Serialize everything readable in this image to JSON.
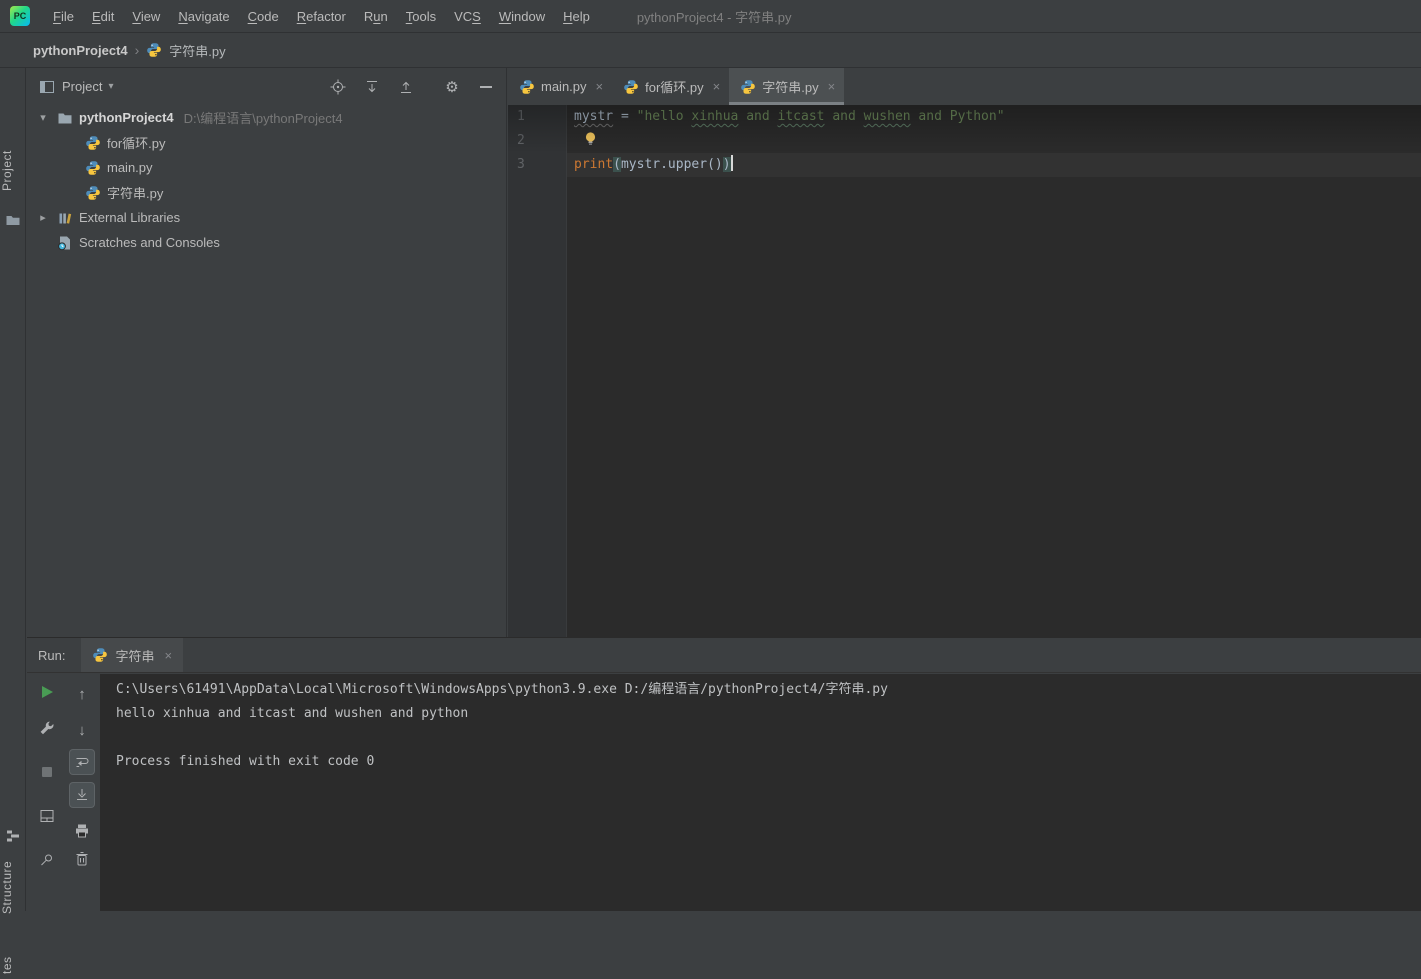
{
  "window": {
    "title": "pythonProject4 - 字符串.py",
    "logo_text": "PC"
  },
  "palette": {
    "panel_bg": "#3c3f41",
    "editor_bg": "#2b2b2b",
    "gutter_bg": "#313335",
    "string_green": "#6a8759",
    "builtin_orange": "#cc7832",
    "default_text": "#a9b7c6",
    "run_green": "#499C54",
    "caret_line": "#323232",
    "paren_match_bg": "#3b514d",
    "line_number": "#606366",
    "ui_text": "#bbbbbb",
    "dim_text": "#787878"
  },
  "icons": {
    "close": "×",
    "chevron_down": "▾",
    "chevron_right": "▸",
    "breadcrumb_sep": "›",
    "dropdown_caret": "▾",
    "gear": "⚙",
    "up_arrow": "↑",
    "down_arrow": "↓"
  },
  "menubar": {
    "items": [
      {
        "label": "File",
        "mnemonic": 0
      },
      {
        "label": "Edit",
        "mnemonic": 0
      },
      {
        "label": "View",
        "mnemonic": 0
      },
      {
        "label": "Navigate",
        "mnemonic": 0
      },
      {
        "label": "Code",
        "mnemonic": 0
      },
      {
        "label": "Refactor",
        "mnemonic": 0
      },
      {
        "label": "Run",
        "mnemonic": 1
      },
      {
        "label": "Tools",
        "mnemonic": 0
      },
      {
        "label": "VCS",
        "mnemonic": 2
      },
      {
        "label": "Window",
        "mnemonic": 0
      },
      {
        "label": "Help",
        "mnemonic": 0
      }
    ]
  },
  "breadcrumb": {
    "project": "pythonProject4",
    "file": "字符串.py"
  },
  "left_stripe": {
    "project_label": "Project",
    "structure_label": "Structure",
    "favorites_label_partial": "tes"
  },
  "project_panel": {
    "title": "Project",
    "tree": [
      {
        "kind": "root",
        "label": "pythonProject4",
        "path": "D:\\编程语言\\pythonProject4",
        "chevron": "down",
        "icon": "folder"
      },
      {
        "kind": "file",
        "label": "for循环.py",
        "icon": "python"
      },
      {
        "kind": "file",
        "label": "main.py",
        "icon": "python"
      },
      {
        "kind": "file",
        "label": "字符串.py",
        "icon": "python"
      },
      {
        "kind": "node",
        "label": "External Libraries",
        "chevron": "right",
        "icon": "library"
      },
      {
        "kind": "node2",
        "label": "Scratches and Consoles",
        "icon": "scratch"
      }
    ]
  },
  "editor": {
    "tabs": [
      {
        "label": "main.py",
        "active": false
      },
      {
        "label": "for循环.py",
        "active": false
      },
      {
        "label": "字符串.py",
        "active": true
      }
    ],
    "lines": [
      {
        "num": "1",
        "tokens": [
          {
            "t": "mystr",
            "k": "plain-typo"
          },
          {
            "t": " = ",
            "k": "plain"
          },
          {
            "t": "\"hello ",
            "k": "str"
          },
          {
            "t": "xinhua",
            "k": "str-typo"
          },
          {
            "t": " and ",
            "k": "str"
          },
          {
            "t": "itcast",
            "k": "str-typo"
          },
          {
            "t": " and ",
            "k": "str"
          },
          {
            "t": "wushen",
            "k": "str-typo"
          },
          {
            "t": " and Python\"",
            "k": "str"
          }
        ]
      },
      {
        "num": "2",
        "bulb": true,
        "tokens": []
      },
      {
        "num": "3",
        "caret": true,
        "tokens": [
          {
            "t": "print",
            "k": "builtin"
          },
          {
            "t": "(",
            "k": "paren-match"
          },
          {
            "t": "mystr.upper",
            "k": "plain"
          },
          {
            "t": "(",
            "k": "plain"
          },
          {
            "t": ")",
            "k": "plain"
          },
          {
            "t": ")",
            "k": "paren-match"
          }
        ]
      }
    ]
  },
  "run_panel": {
    "run_label": "Run:",
    "tab": {
      "label": "字符串"
    },
    "console_lines": [
      "C:\\Users\\61491\\AppData\\Local\\Microsoft\\WindowsApps\\python3.9.exe D:/编程语言/pythonProject4/字符串.py",
      "hello xinhua and itcast and wushen and python",
      "",
      "Process finished with exit code 0"
    ]
  }
}
